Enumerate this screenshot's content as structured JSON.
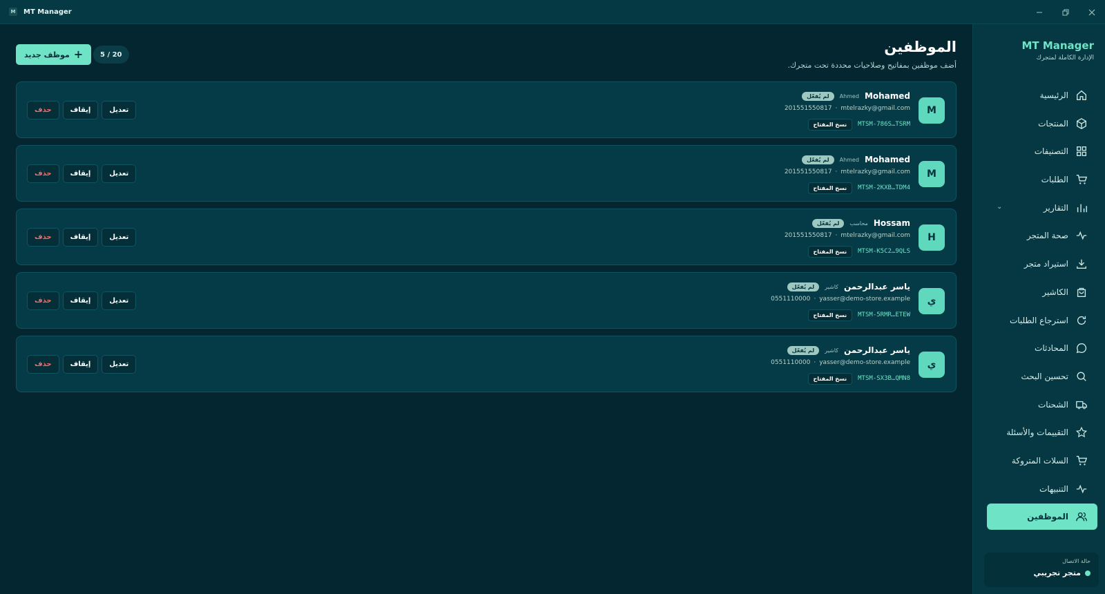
{
  "window": {
    "title": "MT Manager",
    "logo_letter": "M"
  },
  "header": {
    "title": "الموظفين",
    "subtitle": "أضف موظفين بمفاتيح وصلاحيات محددة تحت متجرك.",
    "new_button": "موظف جديد",
    "counter": "5 / 20"
  },
  "employees": [
    {
      "initial": "M",
      "name": "Mohamed",
      "role": "Ahmed",
      "badge": "لم يُفعّل",
      "email": "mtelrazky@gmail.com",
      "phone": "201551550817",
      "key": "MTSM-786S…TSRM",
      "copy": "نسخ المفتاح",
      "edit": "تعديل",
      "stop": "إيقاف",
      "delete": "حذف"
    },
    {
      "initial": "M",
      "name": "Mohamed",
      "role": "Ahmed",
      "badge": "لم يُفعّل",
      "email": "mtelrazky@gmail.com",
      "phone": "201551550817",
      "key": "MTSM-2KXB…TDM4",
      "copy": "نسخ المفتاح",
      "edit": "تعديل",
      "stop": "إيقاف",
      "delete": "حذف"
    },
    {
      "initial": "H",
      "name": "Hossam",
      "role": "محاسب",
      "badge": "لم يُفعّل",
      "email": "mtelrazky@gmail.com",
      "phone": "201551550817",
      "key": "MTSM-K5C2…9QLS",
      "copy": "نسخ المفتاح",
      "edit": "تعديل",
      "stop": "إيقاف",
      "delete": "حذف"
    },
    {
      "initial": "ي",
      "name": "ياسر عبدالرحمن",
      "role": "كاشير",
      "badge": "لم يُفعّل",
      "email": "yasser@demo-store.example",
      "phone": "0551110000",
      "key": "MTSM-5RMR…ETEW",
      "copy": "نسخ المفتاح",
      "edit": "تعديل",
      "stop": "إيقاف",
      "delete": "حذف"
    },
    {
      "initial": "ي",
      "name": "ياسر عبدالرحمن",
      "role": "كاشير",
      "badge": "لم يُفعّل",
      "email": "yasser@demo-store.example",
      "phone": "0551110000",
      "key": "MTSM-SX3B…QMN8",
      "copy": "نسخ المفتاح",
      "edit": "تعديل",
      "stop": "إيقاف",
      "delete": "حذف"
    }
  ],
  "sidebar": {
    "brand": "MT Manager",
    "brand_sub": "الإدارة الكاملة لمتجرك",
    "items": [
      {
        "label": "الرئيسية",
        "icon": "home-icon"
      },
      {
        "label": "المنتجات",
        "icon": "box-icon"
      },
      {
        "label": "التصنيفات",
        "icon": "grid-icon"
      },
      {
        "label": "الطلبات",
        "icon": "cart-icon"
      },
      {
        "label": "التقارير",
        "icon": "bar-chart-icon"
      },
      {
        "label": "صحة المتجر",
        "icon": "pulse-icon"
      },
      {
        "label": "استيراد متجر",
        "icon": "download-icon"
      },
      {
        "label": "الكاشير",
        "icon": "bag-icon"
      },
      {
        "label": "استرجاع الطلبات",
        "icon": "refresh-icon"
      },
      {
        "label": "المحادثات",
        "icon": "chat-icon"
      },
      {
        "label": "تحسين البحث",
        "icon": "search-icon"
      },
      {
        "label": "الشحنات",
        "icon": "truck-icon"
      },
      {
        "label": "التقييمات والأسئلة",
        "icon": "star-icon"
      },
      {
        "label": "السلات المتروكة",
        "icon": "cart-icon"
      },
      {
        "label": "التنبيهات",
        "icon": "pulse-icon"
      },
      {
        "label": "الموظفين",
        "icon": "users-icon"
      }
    ],
    "connection_label": "حالة الاتصال",
    "connection_status": "متجر تجريبي"
  },
  "colors": {
    "accent": "#6fe3c5",
    "background": "#032630",
    "card": "#053b47",
    "danger": "#f06b6b"
  }
}
